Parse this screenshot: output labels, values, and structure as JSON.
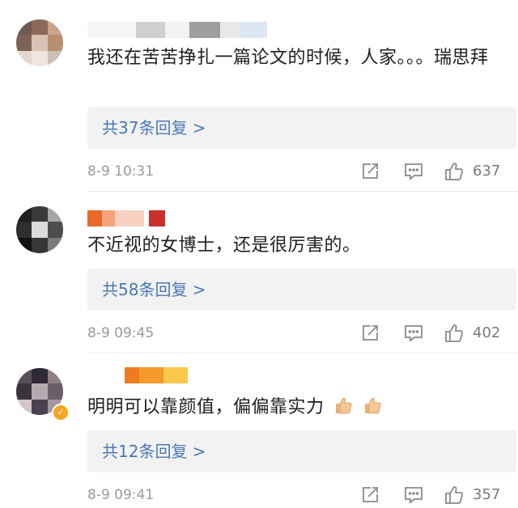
{
  "colors": {
    "reply_link": "#4a78b3",
    "meta": "#9a9a9a",
    "reply_bg": "#f2f2f2"
  },
  "comments": [
    {
      "text": "我还在苦苦挣扎一篇论文的时候，人家。。。瑞思拜",
      "replies_label": "共37条回复 >",
      "time": "8-9 10:31",
      "likes": "637",
      "icons": [
        "share-icon",
        "comment-icon",
        "like-icon"
      ]
    },
    {
      "text": "不近视的女博士，还是很厉害的。",
      "replies_label": "共58条回复 >",
      "time": "8-9 09:45",
      "likes": "402",
      "icons": [
        "share-icon",
        "comment-icon",
        "like-icon"
      ]
    },
    {
      "text": "明明可以靠颜值，偏偏靠实力",
      "replies_label": "共12条回复 >",
      "time": "8-9 09:41",
      "likes": "357",
      "icons": [
        "share-icon",
        "comment-icon",
        "like-icon",
        "thumbs-up-emoji-icon",
        "verified-badge-icon"
      ]
    }
  ]
}
